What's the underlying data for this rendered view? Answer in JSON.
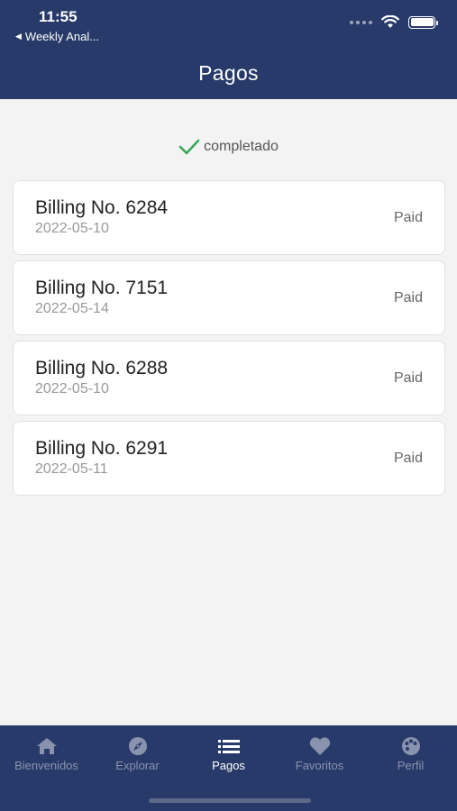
{
  "status_bar": {
    "time": "11:55",
    "back_app": "Weekly Anal...",
    "icons": [
      "cellular-dots-icon",
      "wifi-icon",
      "battery-icon"
    ]
  },
  "header": {
    "title": "Pagos"
  },
  "filter": {
    "label": "completado",
    "icon": "checkmark-icon",
    "icon_color": "#3aa757"
  },
  "payments": [
    {
      "name": "Billing No. 6284",
      "date": "2022-05-10",
      "status": "Paid"
    },
    {
      "name": "Billing No. 7151",
      "date": "2022-05-14",
      "status": "Paid"
    },
    {
      "name": "Billing No. 6288",
      "date": "2022-05-10",
      "status": "Paid"
    },
    {
      "name": "Billing No. 6291",
      "date": "2022-05-11",
      "status": "Paid"
    }
  ],
  "tabs": [
    {
      "label": "Bienvenidos",
      "icon": "home-icon",
      "active": false
    },
    {
      "label": "Explorar",
      "icon": "compass-icon",
      "active": false
    },
    {
      "label": "Pagos",
      "icon": "list-icon",
      "active": true
    },
    {
      "label": "Favoritos",
      "icon": "heart-icon",
      "active": false
    },
    {
      "label": "Perfil",
      "icon": "palette-icon",
      "active": false
    }
  ],
  "colors": {
    "header_bg": "#283a69",
    "background": "#f3f3f3",
    "tab_inactive": "#8a93ae",
    "tab_active": "#ffffff"
  }
}
